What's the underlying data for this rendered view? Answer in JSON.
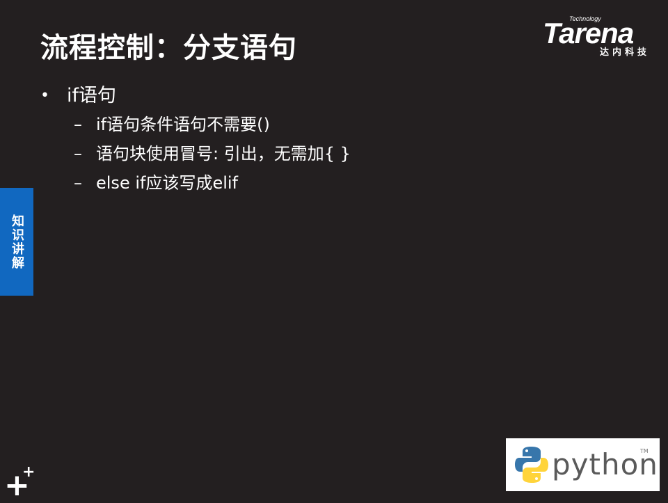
{
  "slide": {
    "title": "流程控制：分支语句",
    "logo": {
      "tagline": "Technology",
      "brand": "Tarena",
      "subtitle_cn": "达内科技"
    },
    "bullets": [
      {
        "text": "if语句",
        "children": [
          "if语句条件语句不需要()",
          "语句块使用冒号: 引出，无需加{ }",
          "else if应该写成elif"
        ]
      }
    ],
    "side_tab_label": "知识讲解",
    "corner_decoration": [
      "+",
      "+"
    ],
    "python_badge": {
      "word": "python",
      "tm": "TM"
    },
    "colors": {
      "background": "#231f20",
      "text": "#ffffff",
      "side_tab": "#1168c0",
      "python_blue": "#3776ab",
      "python_yellow": "#ffd43b"
    }
  },
  "markers": {
    "level1": "•",
    "level2": "–"
  }
}
